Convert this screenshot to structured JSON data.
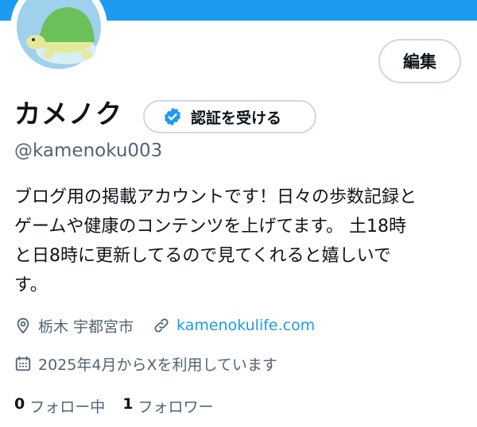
{
  "colors": {
    "accent": "#1d9bf0",
    "secondary_text": "#536471",
    "primary_text": "#0f1419"
  },
  "profile": {
    "avatar_icon": "turtle-avatar",
    "edit_label": "編集",
    "name": "カメノク",
    "verify_label": "認証を受ける",
    "verify_icon": "verified-badge-icon",
    "handle": "@kamenoku003",
    "bio": "ブログ用の掲載アカウントです！日々の歩数記録と\nゲームや健康のコンテンツを上げてます。 土18時\nと日8時に更新してるので見てくれると嬉しいで\nす。",
    "location": "栃木 宇都宮市",
    "location_icon": "location-pin-icon",
    "url": "kamenokulife.com",
    "url_icon": "link-icon",
    "joined": "2025年4月からXを利用しています",
    "joined_icon": "calendar-icon",
    "following_count": "0",
    "following_label": "フォロー中",
    "followers_count": "1",
    "followers_label": "フォロワー"
  }
}
